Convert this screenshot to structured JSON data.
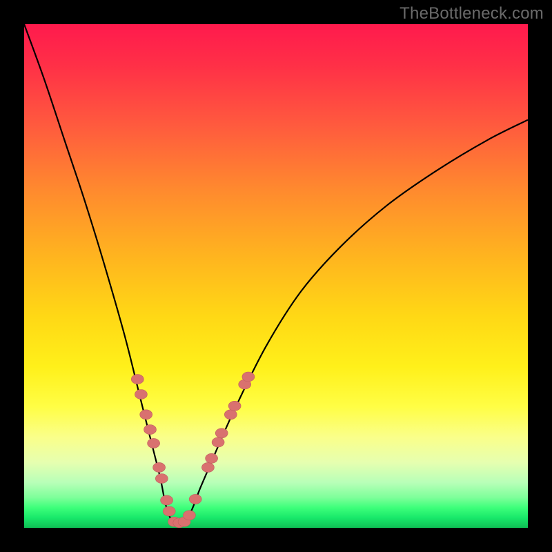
{
  "watermark": "TheBottleneck.com",
  "colors": {
    "background": "#000000",
    "curve_stroke": "#000000",
    "marker_fill": "#d9716f",
    "marker_stroke": "#c05f5e"
  },
  "chart_data": {
    "type": "line",
    "title": "",
    "xlabel": "",
    "ylabel": "",
    "xlim": [
      0,
      100
    ],
    "ylim": [
      0,
      100
    ],
    "grid": false,
    "legend": false,
    "series": [
      {
        "name": "bottleneck-curve",
        "x": [
          0,
          4,
          8,
          12,
          16,
          20,
          23,
          25,
          27,
          28,
          29,
          30,
          31,
          33,
          35,
          38,
          42,
          48,
          55,
          63,
          72,
          82,
          92,
          100
        ],
        "y": [
          100,
          89,
          77,
          65,
          52,
          38,
          26,
          18,
          10,
          5,
          2,
          1,
          1,
          3,
          8,
          15,
          24,
          36,
          47,
          56,
          64,
          71,
          77,
          81
        ]
      }
    ],
    "markers": [
      {
        "x": 22.5,
        "y": 29.5
      },
      {
        "x": 23.2,
        "y": 26.5
      },
      {
        "x": 24.2,
        "y": 22.5
      },
      {
        "x": 25.0,
        "y": 19.5
      },
      {
        "x": 25.7,
        "y": 16.8
      },
      {
        "x": 26.8,
        "y": 12.0
      },
      {
        "x": 27.3,
        "y": 9.8
      },
      {
        "x": 28.3,
        "y": 5.5
      },
      {
        "x": 28.8,
        "y": 3.3
      },
      {
        "x": 29.8,
        "y": 1.2
      },
      {
        "x": 30.8,
        "y": 1.0
      },
      {
        "x": 31.8,
        "y": 1.2
      },
      {
        "x": 32.8,
        "y": 2.5
      },
      {
        "x": 34.0,
        "y": 5.7
      },
      {
        "x": 36.5,
        "y": 12.0
      },
      {
        "x": 37.2,
        "y": 13.8
      },
      {
        "x": 38.5,
        "y": 17.0
      },
      {
        "x": 39.2,
        "y": 18.8
      },
      {
        "x": 41.0,
        "y": 22.5
      },
      {
        "x": 41.8,
        "y": 24.2
      },
      {
        "x": 43.8,
        "y": 28.5
      },
      {
        "x": 44.5,
        "y": 30.0
      }
    ]
  }
}
